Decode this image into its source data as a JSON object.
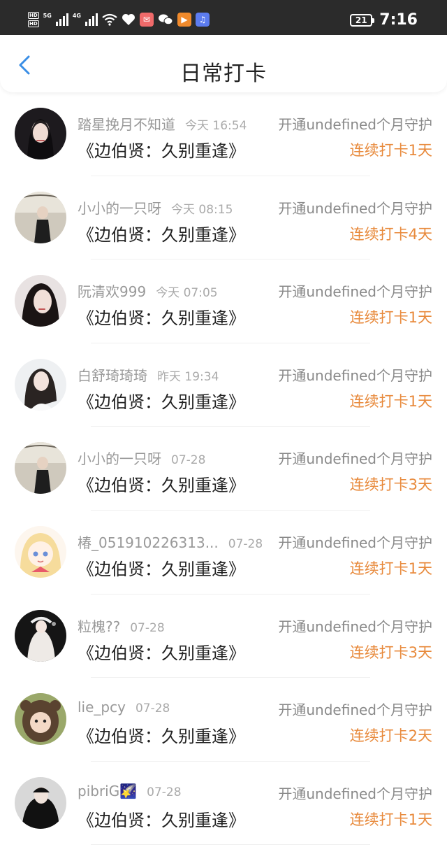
{
  "status_bar": {
    "hd_top": "HD",
    "hd_bottom": "HD",
    "net1": "5G",
    "net2": "4G",
    "battery": "21",
    "time": "7:16"
  },
  "nav": {
    "back_icon": "chevron-left-icon",
    "title": "日常打卡"
  },
  "records": [
    {
      "user": "踏星挽月不知道",
      "time": "今天 16:54",
      "book": "《边伯贤：久别重逢》",
      "guard": "开通undefined个月守护",
      "streak": "连续打卡1天"
    },
    {
      "user": "小小的一只呀",
      "time": "今天 08:15",
      "book": "《边伯贤：久别重逢》",
      "guard": "开通undefined个月守护",
      "streak": "连续打卡4天"
    },
    {
      "user": "阮清欢999",
      "time": "今天 07:05",
      "book": "《边伯贤：久别重逢》",
      "guard": "开通undefined个月守护",
      "streak": "连续打卡1天"
    },
    {
      "user": "白舒琦琦琦",
      "time": "昨天 19:34",
      "book": "《边伯贤：久别重逢》",
      "guard": "开通undefined个月守护",
      "streak": "连续打卡1天"
    },
    {
      "user": "小小的一只呀",
      "time": "07-28",
      "book": "《边伯贤：久别重逢》",
      "guard": "开通undefined个月守护",
      "streak": "连续打卡3天"
    },
    {
      "user": "椿_051910226313...",
      "time": "07-28",
      "book": "《边伯贤：久别重逢》",
      "guard": "开通undefined个月守护",
      "streak": "连续打卡1天"
    },
    {
      "user": "粒槐??",
      "time": "07-28",
      "book": "《边伯贤：久别重逢》",
      "guard": "开通undefined个月守护",
      "streak": "连续打卡3天"
    },
    {
      "user": "lie_pcy",
      "time": "07-28",
      "book": "《边伯贤：久别重逢》",
      "guard": "开通undefined个月守护",
      "streak": "连续打卡2天"
    },
    {
      "user": "pibriG🌠",
      "time": "07-28",
      "book": "《边伯贤：久别重逢》",
      "guard": "开通undefined个月守护",
      "streak": "连续打卡1天"
    }
  ],
  "colors": {
    "accent_blue": "#3a8ee6",
    "streak_orange": "#e88a3c"
  }
}
